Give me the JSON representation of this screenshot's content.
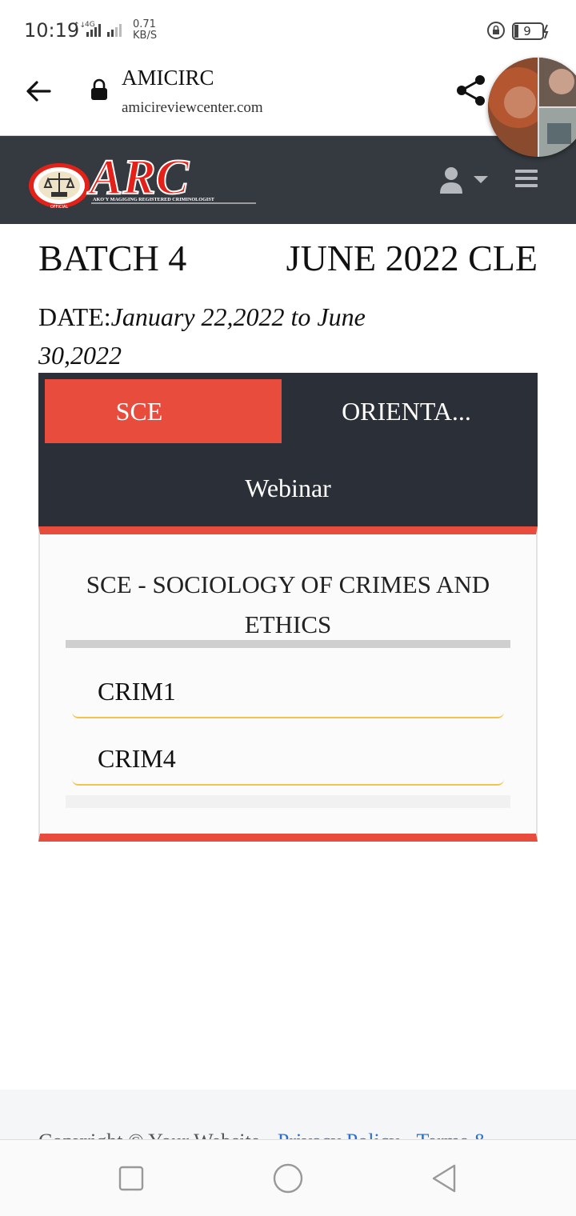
{
  "status_bar": {
    "time": "10:19",
    "network": "4G",
    "speed_value": "0.71",
    "speed_unit": "KB/S",
    "battery": "9"
  },
  "browser": {
    "site_name": "AMICIRC",
    "url": "amicireviewcenter.com",
    "icons": [
      "back-arrow-icon",
      "lock-icon",
      "share-icon"
    ]
  },
  "header": {
    "logo_text": "ARC",
    "logo_tagline": "AKO'Y MAGIGING REGISTERED CRIMINOLOGIST",
    "logo_seal_text": "OFFICIAL",
    "icons": [
      "user-icon",
      "caret-down-icon",
      "hamburger-icon"
    ],
    "brand_color": "#e32119",
    "bg_color": "#343a40"
  },
  "main": {
    "batch_label": "BATCH 4",
    "exam_label": "JUNE 2022 CLE",
    "date_prefix": "DATE:",
    "date_range_line1": "January 22,2022 to June",
    "date_range_line2": "30,2022",
    "tabs": [
      {
        "label": "SCE",
        "active": true
      },
      {
        "label": "ORIENTA...",
        "active": false
      },
      {
        "label": "Webinar",
        "active": false
      }
    ],
    "panel": {
      "title": "SCE - SOCIOLOGY OF CRIMES AND ETHICS",
      "items": [
        "CRIM1",
        "CRIM4"
      ]
    },
    "accent_color": "#e74c3c",
    "item_underline_color": "#f5c24c"
  },
  "footer": {
    "copyright": "Copyright © Your Website",
    "links": [
      "Privacy Policy",
      "Terms &"
    ]
  },
  "nav_bar": {
    "icons": [
      "recents-square-icon",
      "home-circle-icon",
      "back-triangle-icon"
    ]
  }
}
